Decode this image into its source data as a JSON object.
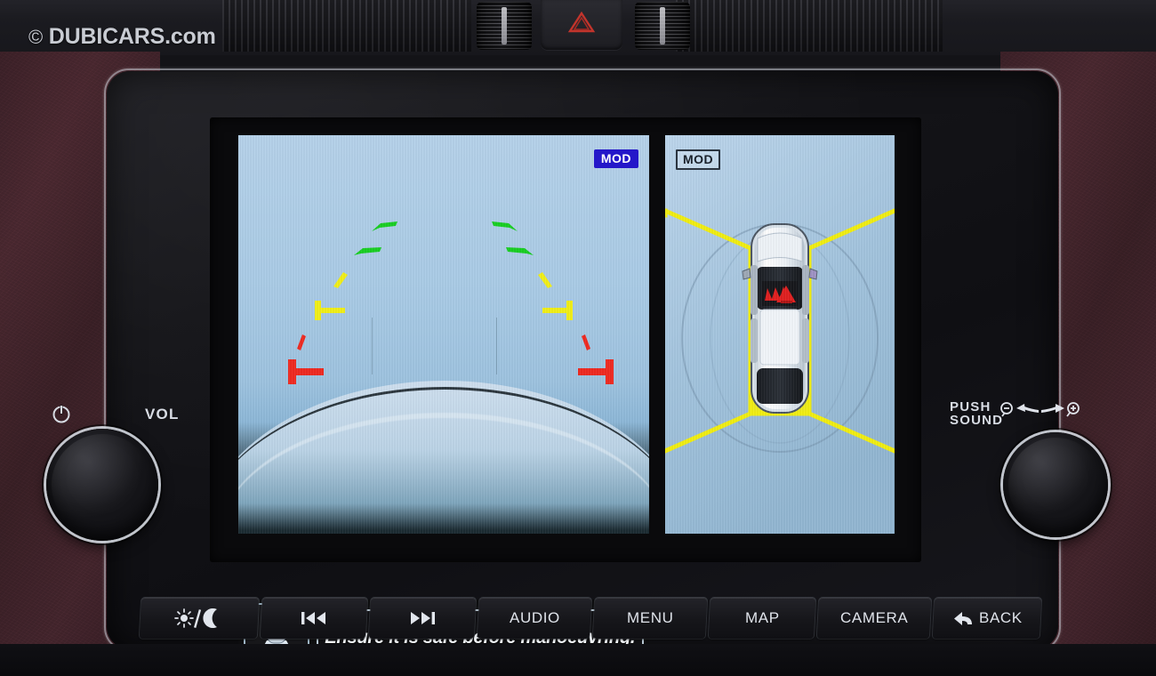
{
  "watermark": {
    "symbol": "©",
    "text": "DUBICARS.com"
  },
  "dashboard": {
    "hazard_button": {
      "icon": "hazard-triangle-icon"
    },
    "vents": {
      "left": "air-vent-left",
      "right": "air-vent-right"
    }
  },
  "screen": {
    "rear_view": {
      "mod_badge": "MOD",
      "mod_badge_state": "active",
      "guide_colors": {
        "near": "#ee2b22",
        "mid": "#eeee19",
        "far": "#17cc22"
      },
      "guide_markers": [
        {
          "side": "left",
          "zone": "far",
          "color": "#17cc22"
        },
        {
          "side": "left",
          "zone": "far",
          "color": "#17cc22"
        },
        {
          "side": "left",
          "zone": "mid",
          "color": "#eeee19"
        },
        {
          "side": "left",
          "zone": "mid",
          "color": "#eeee19"
        },
        {
          "side": "left",
          "zone": "near",
          "color": "#ee2b22"
        },
        {
          "side": "left",
          "zone": "near",
          "color": "#ee2b22"
        },
        {
          "side": "right",
          "zone": "far",
          "color": "#17cc22"
        },
        {
          "side": "right",
          "zone": "far",
          "color": "#17cc22"
        },
        {
          "side": "right",
          "zone": "mid",
          "color": "#eeee19"
        },
        {
          "side": "right",
          "zone": "mid",
          "color": "#eeee19"
        },
        {
          "side": "right",
          "zone": "near",
          "color": "#ee2b22"
        },
        {
          "side": "right",
          "zone": "near",
          "color": "#ee2b22"
        }
      ]
    },
    "warning": {
      "icon": "car-rear-camera-icon",
      "message": "Ensure it is safe before manoeuvring."
    },
    "around_view": {
      "mod_badge": "MOD",
      "mod_badge_state": "idle",
      "vehicle_icon": "top-down-car-icon",
      "alert_icon": "moving-object-detection-icon",
      "guide_line_color": "#f2ee12"
    }
  },
  "controls": {
    "left_knob": {
      "power_icon": "power-icon",
      "label": "VOL"
    },
    "right_knob": {
      "label_line1": "PUSH",
      "label_line2": "SOUND",
      "zoom_out_icon": "zoom-out-icon",
      "arrow_left_icon": "arrow-left-icon",
      "arrow_right_icon": "arrow-right-icon",
      "zoom_in_icon": "zoom-in-icon"
    },
    "buttons": [
      {
        "id": "daynight",
        "label": "",
        "icon": "sun-moon-icon"
      },
      {
        "id": "prev",
        "label": "",
        "icon": "previous-track-icon"
      },
      {
        "id": "next",
        "label": "",
        "icon": "next-track-icon"
      },
      {
        "id": "audio",
        "label": "AUDIO",
        "icon": ""
      },
      {
        "id": "menu",
        "label": "MENU",
        "icon": ""
      },
      {
        "id": "map",
        "label": "MAP",
        "icon": ""
      },
      {
        "id": "camera",
        "label": "CAMERA",
        "icon": ""
      },
      {
        "id": "back",
        "label": "BACK",
        "icon": "back-arrow-icon"
      }
    ]
  }
}
